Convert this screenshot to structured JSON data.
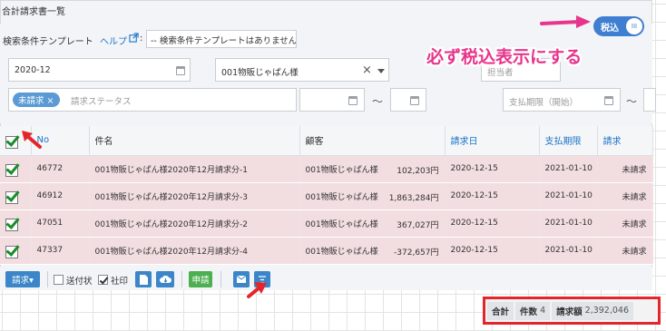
{
  "title": "合計請求書一覧",
  "template": {
    "label": "検索条件テンプレート",
    "help": "ヘルプ",
    "colon": ":",
    "placeholder": "-- 検索条件テンプレートはありません"
  },
  "filters": {
    "month": "2020-12",
    "customer": "001物販じゃぱん様",
    "assignee_placeholder": "担当者",
    "status_tag": "未請求",
    "status_placeholder": "請求ステータス",
    "tilde": "～",
    "due_start_placeholder": "支払期限（開始）"
  },
  "toggle": {
    "label": "税込",
    "knob": "III"
  },
  "annotation": "必ず税込表示にする",
  "table": {
    "headers": [
      "",
      "No",
      "件名",
      "顧客",
      "",
      "請求日",
      "支払期限",
      "請求"
    ],
    "rows": [
      {
        "no": "46772",
        "subject": "001物販じゃぱん様2020年12月請求分-1",
        "customer": "001物販じゃぱん様",
        "amount": "102,203円",
        "date": "2020-12-15",
        "due": "2021-01-10",
        "status": "未請求"
      },
      {
        "no": "46912",
        "subject": "001物販じゃぱん様2020年12月請求分-3",
        "customer": "001物販じゃぱん様",
        "amount": "1,863,284円",
        "date": "2020-12-15",
        "due": "2021-01-10",
        "status": "未請求"
      },
      {
        "no": "47051",
        "subject": "001物販じゃぱん様2020年12月請求分-2",
        "customer": "001物販じゃぱん様",
        "amount": "367,027円",
        "date": "2020-12-15",
        "due": "2021-01-10",
        "status": "未請求"
      },
      {
        "no": "47337",
        "subject": "001物販じゃぱん様2020年12月請求分-4",
        "customer": "001物販じゃぱん様",
        "amount": "-372,657円",
        "date": "2020-12-15",
        "due": "2021-01-10",
        "status": "未請求"
      }
    ]
  },
  "toolbar": {
    "invoice_button": "請求▾",
    "send_label": "送付状",
    "stamp_label": "社印",
    "apply_button": "申請"
  },
  "summary": {
    "total_label": "合計",
    "count_label": "件数",
    "count_value": "4",
    "amount_label": "請求額",
    "amount_value": "2,392,046"
  },
  "colors": {
    "accent": "#1a73c8",
    "row_bg": "#f2dde0",
    "annotation": "#e8358c",
    "highlight_box": "#e3262b",
    "toggle": "#3f7fd1"
  }
}
